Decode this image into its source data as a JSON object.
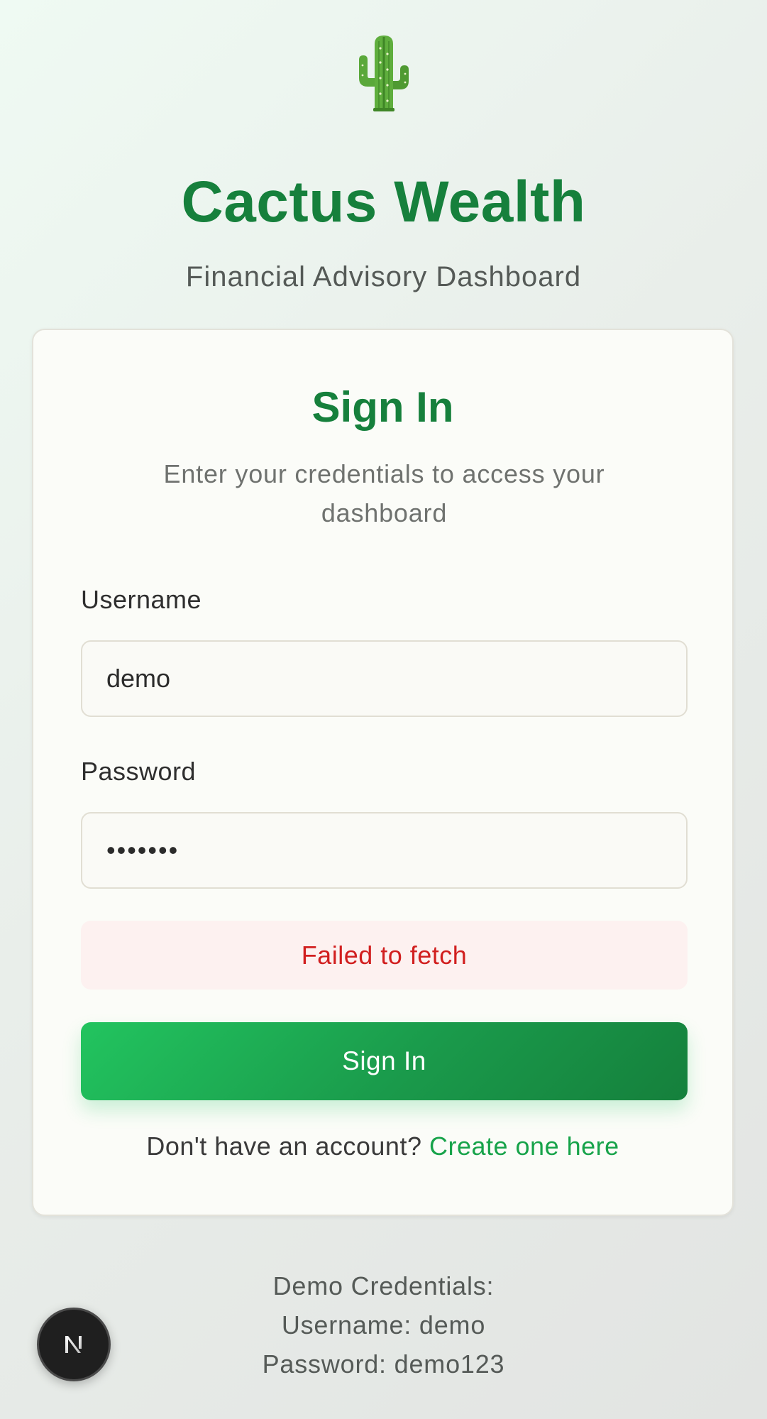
{
  "brand": {
    "logo_icon": "cactus-icon",
    "title": "Cactus Wealth",
    "subtitle": "Financial Advisory Dashboard"
  },
  "login_card": {
    "title": "Sign In",
    "description": "Enter your credentials to access your dashboard",
    "username": {
      "label": "Username",
      "value": "demo"
    },
    "password": {
      "label": "Password",
      "value": "demo123"
    },
    "error_message": "Failed to fetch",
    "submit_label": "Sign In",
    "signup_prompt": "Don't have an account?",
    "signup_link": "Create one here"
  },
  "demo_credentials": {
    "heading": "Demo Credentials:",
    "username_line": "Username: demo",
    "password_line": "Password: demo123"
  },
  "dev_badge": {
    "icon": "nextjs-icon"
  },
  "colors": {
    "brand_green": "#16803c",
    "link_green": "#17a34a",
    "button_gradient_start": "#22c45f",
    "button_gradient_end": "#15803c",
    "error_text": "#d11f1f",
    "error_bg": "#fdf1f0"
  }
}
